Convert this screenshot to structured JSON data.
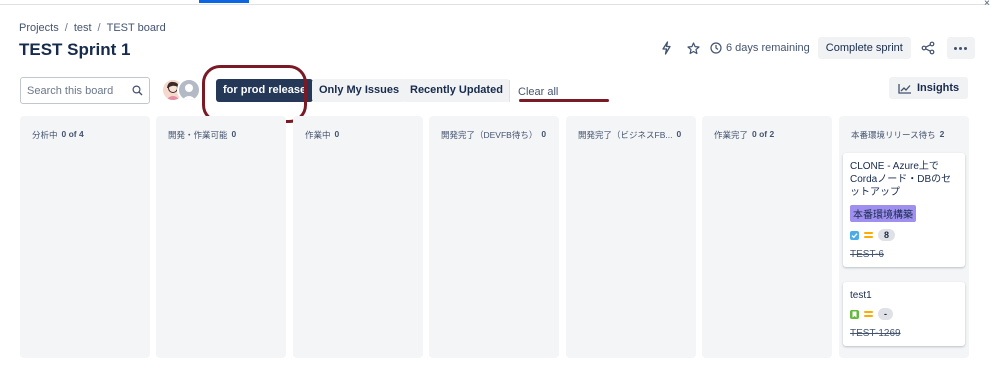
{
  "breadcrumb": [
    "Projects",
    "test",
    "TEST board"
  ],
  "page_title": "TEST Sprint 1",
  "header": {
    "remaining": "6 days remaining",
    "complete_sprint": "Complete sprint"
  },
  "toolbar": {
    "search_placeholder": "Search this board",
    "filters": [
      "for prod release",
      "Only My Issues",
      "Recently Updated"
    ],
    "clear_all": "Clear all",
    "insights": "Insights"
  },
  "columns": [
    {
      "name": "分析中",
      "count": "0 of 4"
    },
    {
      "name": "開発・作業可能",
      "count": "0"
    },
    {
      "name": "作業中",
      "count": "0"
    },
    {
      "name": "開発完了（DEVFB待ち）",
      "count": "0"
    },
    {
      "name": "開発完了（ビジネスFB...",
      "count": "0"
    },
    {
      "name": "作業完了",
      "count": "0 of 2"
    },
    {
      "name": "本番環境リリース待ち",
      "count": "2"
    }
  ],
  "cards": [
    {
      "title": "CLONE - Azure上でCordaノード・DBのセットアップ",
      "label": "本番環境構築",
      "points": "8",
      "key": "TEST-6",
      "type": "task"
    },
    {
      "title": "test1",
      "points": "-",
      "key": "TEST-1269",
      "type": "story"
    }
  ],
  "colors": {
    "annotation": "#7a1a24",
    "primary_filter": "#253858",
    "label": "#9f8fef"
  }
}
